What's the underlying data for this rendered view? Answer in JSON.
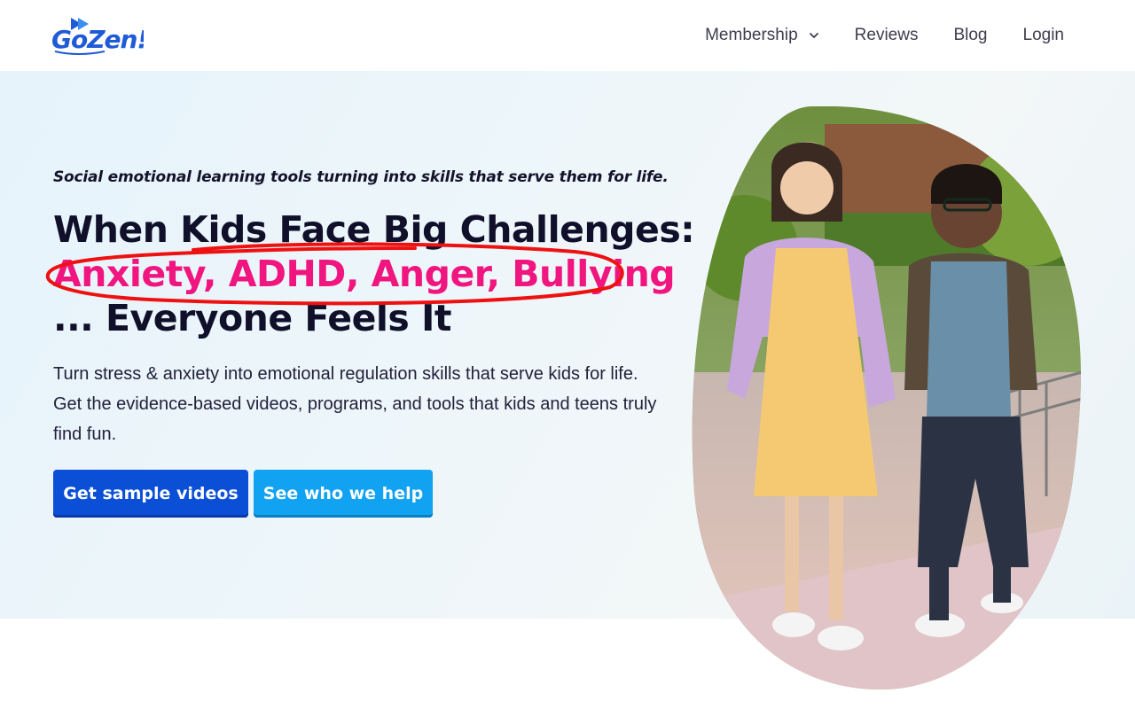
{
  "brand": {
    "logo_text": "GoZen!"
  },
  "nav": {
    "items": [
      {
        "label": "Membership",
        "has_dropdown": true
      },
      {
        "label": "Reviews"
      },
      {
        "label": "Blog"
      },
      {
        "label": "Login"
      }
    ]
  },
  "hero": {
    "tagline": "Social emotional learning tools turning into skills that serve them for life.",
    "headline_line1": "When Kids Face Big Challenges:",
    "headline_line2": "Anxiety, ADHD, Anger, Bullying",
    "headline_line3": "... Everyone Feels It",
    "body": "Turn stress & anxiety into emotional regulation skills that serve kids for life. Get the evidence-based videos, programs, and tools that kids and teens truly find fun.",
    "primary_button": "Get sample videos",
    "secondary_button": "See who we help"
  },
  "colors": {
    "brand_blue": "#1f5bd6",
    "accent_pink": "#f0157f",
    "annotation_red": "#ee1111",
    "primary_button": "#0a4fd6",
    "secondary_button": "#12a2f2"
  },
  "icons": {
    "dropdown": "chevron-down-icon",
    "logo_arrow": "play-arrow-icon"
  }
}
